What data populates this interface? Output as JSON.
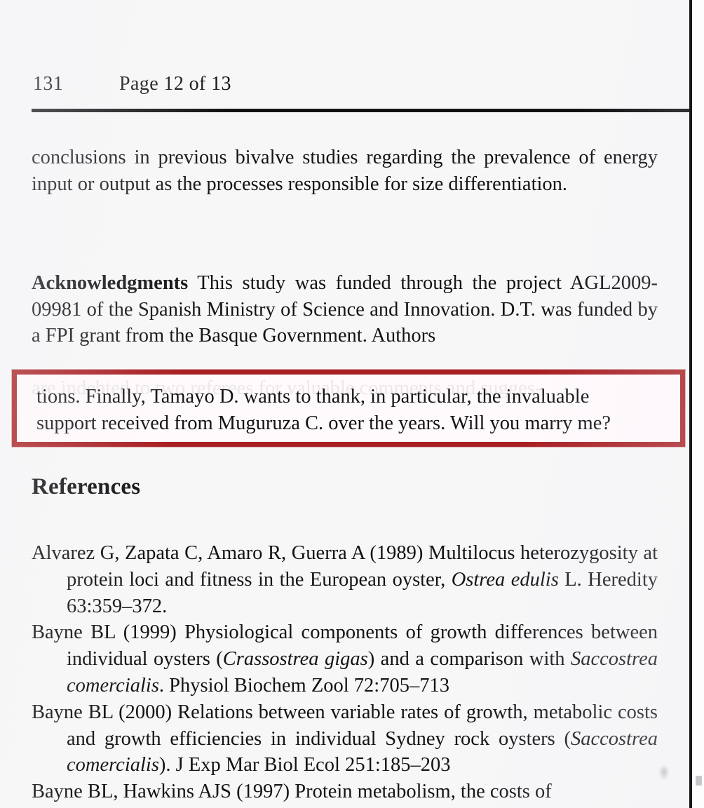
{
  "header": {
    "folio": "131",
    "page_label": "Page 12 of 13"
  },
  "body": {
    "paragraph_conclusions": "conclusions in previous bivalve studies regarding the prevalence of energy input or output as the processes responsible for size differentiation.",
    "acknowledgments_label": "Acknowledgments",
    "acknowledgments_body": "This study was funded through the project AGL2009-09981 of the Spanish Ministry of Science and Innovation. D.T. was funded by a FPI grant from the Basque Government. Authors",
    "acknowledgments_clipped_line": "are indebted to two referees for valuable comments and sugges-"
  },
  "highlight": {
    "border_color": "#a81f23",
    "line1": "tions. Finally, Tamayo D. wants to thank, in particular, the invaluable",
    "line2": "support received from Muguruza C. over the years. Will you marry me?"
  },
  "references": {
    "heading": "References",
    "entries": [
      {
        "pre": "Alvarez G, Zapata C, Amaro R, Guerra A (1989) Multilocus heterozygosity at protein loci and fitness in the European oyster, ",
        "species": "Ostrea edulis",
        "post": " L. Heredity 63:359–372."
      },
      {
        "pre": "Bayne BL (1999) Physiological components of growth differences between individual oysters (",
        "species": "Crassostrea gigas",
        "mid": ") and a comparison with ",
        "species2": "Saccostrea comercialis",
        "post": ". Physiol Biochem Zool 72:705–713"
      },
      {
        "pre": "Bayne BL (2000) Relations between variable rates of growth, metabolic costs and growth efficiencies in individual Sydney rock oysters (",
        "species": "Saccostrea comercialis",
        "post": "). J Exp Mar Biol Ecol 251:185–203"
      },
      {
        "pre": "Bayne BL, Hawkins AJS (1997) Protein metabolism, the costs of",
        "species": "",
        "post": ""
      }
    ]
  }
}
